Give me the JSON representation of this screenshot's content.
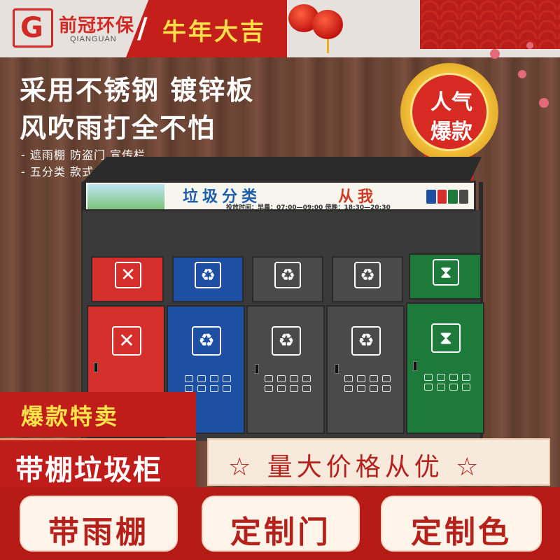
{
  "header": {
    "logo_letter": "G",
    "brand_cn": "前冠环保",
    "brand_en": "QIANGUAN",
    "divider": "/",
    "slogan": "牛年大吉"
  },
  "headline": {
    "line1": "采用不锈钢 镀锌板",
    "line2": "风吹雨打全不怕",
    "bullet1": "- 遮雨棚 防盗门 宣传栏",
    "bullet2": "- 五分类 款式全"
  },
  "badge": {
    "line1": "人气",
    "line2": "爆款"
  },
  "banner": {
    "title1": "垃圾分类",
    "title2": "从我",
    "time": "投放时间：早晨：07:00—09:00  傍晚：18:30—20:30"
  },
  "promo": {
    "hot_sale": "爆款特卖",
    "product": "带棚垃圾柜",
    "price": "☆ 量大价格从优 ☆"
  },
  "features": [
    "带雨棚",
    "定制门",
    "定制色"
  ],
  "colors": {
    "brand_red": "#c01c19",
    "gold": "#ffe44a",
    "bin_red": "#d42f2a",
    "bin_blue": "#1d4fa3",
    "bin_gray": "#4a4a4a",
    "bin_green": "#1e7a3a"
  }
}
